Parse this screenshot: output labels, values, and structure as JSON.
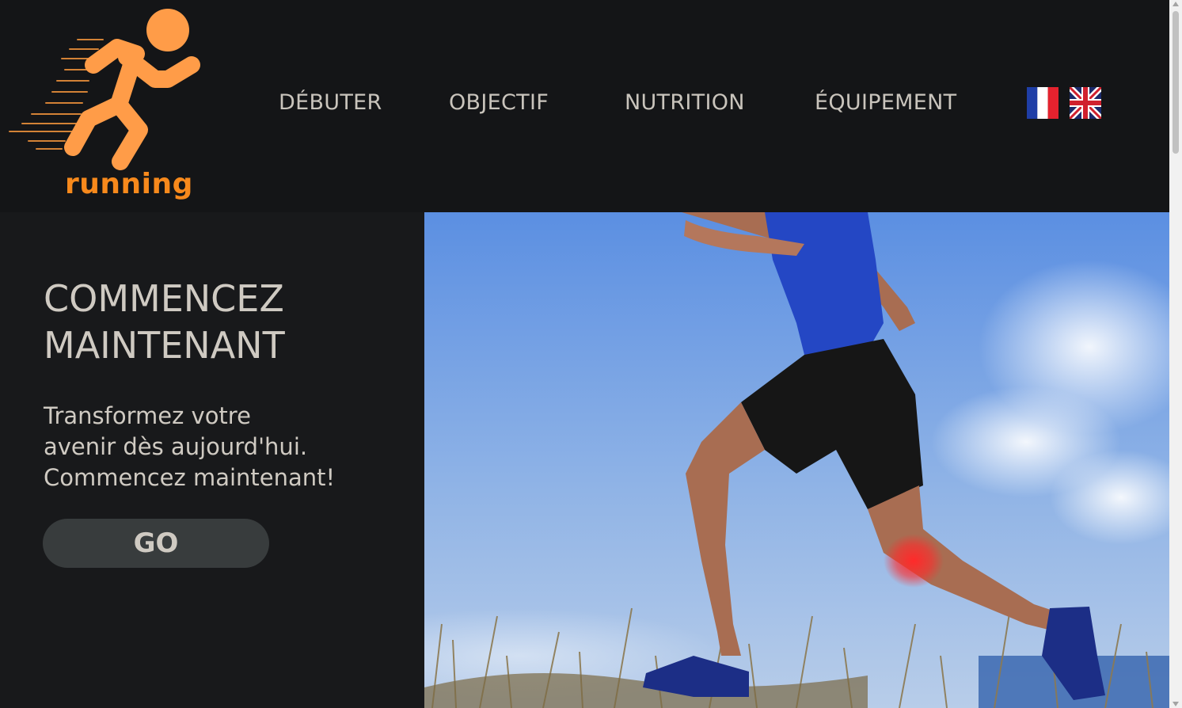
{
  "header": {
    "logo_text": "running",
    "logo_icon": "runner-icon",
    "nav": [
      {
        "label": "DÉBUTER"
      },
      {
        "label": "OBJECTIF"
      },
      {
        "label": "NUTRITION"
      },
      {
        "label": "ÉQUIPEMENT"
      }
    ],
    "languages": [
      {
        "icon": "french-flag-icon"
      },
      {
        "icon": "uk-flag-icon"
      }
    ]
  },
  "hero": {
    "title_line1": "COMMENCEZ",
    "title_line2": "MAINTENANT",
    "text_line1": "Transformez votre",
    "text_line2": "avenir dès aujourd'hui.",
    "text_line3": "Commencez maintenant!",
    "button_label": "GO"
  },
  "colors": {
    "accent": "#f7891c",
    "header_bg": "#141517",
    "page_bg": "#18191b",
    "button_bg": "#383c3d",
    "text": "#cfcac2"
  }
}
